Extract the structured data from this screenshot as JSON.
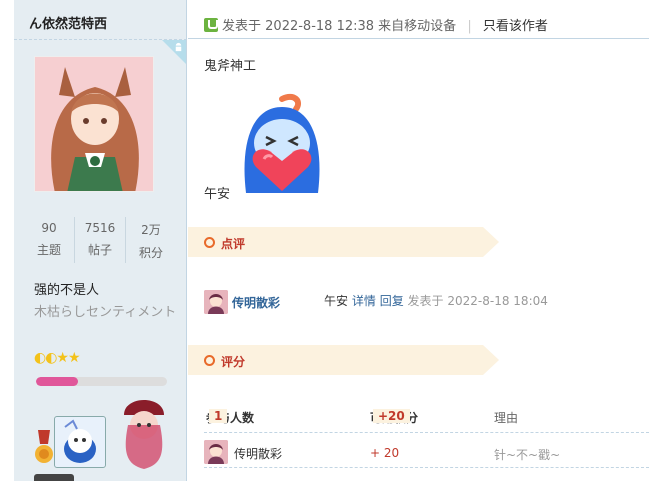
{
  "author": {
    "name": "ん依然范特西",
    "stats": [
      {
        "num": "90",
        "label": "主题"
      },
      {
        "num": "7516",
        "label": "帖子"
      },
      {
        "num": "2万",
        "label": "积分"
      }
    ],
    "user_title": "强的不是人",
    "signature": "木枯らしセンティメント",
    "stars": "◐◐★★",
    "exp_progress": 0.32,
    "device_icon": "android-icon"
  },
  "post": {
    "meta_prefix": "发表于",
    "meta_time": "2022-8-18 12:38",
    "meta_device": "来自移动设备",
    "meta_separator": "|",
    "author_only": "只看该作者",
    "text1": "鬼斧神工",
    "text2": "午安"
  },
  "comments_section": {
    "title": "点评",
    "items": [
      {
        "user": "传明散彩",
        "text": "午安",
        "detail_link": "详情",
        "reply_link": "回复",
        "time_prefix": "发表于",
        "time": "2022-8-18 18:04"
      }
    ]
  },
  "rating_section": {
    "title": "评分",
    "head_participants": "参与人数",
    "participants_count": "1",
    "head_points": "可用积分",
    "points_total": "+20",
    "head_reason": "理由",
    "rows": [
      {
        "user": "传明散彩",
        "score": "+ 20",
        "reason": "针~不~戳~"
      }
    ]
  },
  "colors": {
    "sidebar_bg": "#e5edf2",
    "accent_red": "#c0392b",
    "tag_bg": "#fcf2df",
    "link_blue": "#336699",
    "exp_pink": "#e0579a"
  }
}
